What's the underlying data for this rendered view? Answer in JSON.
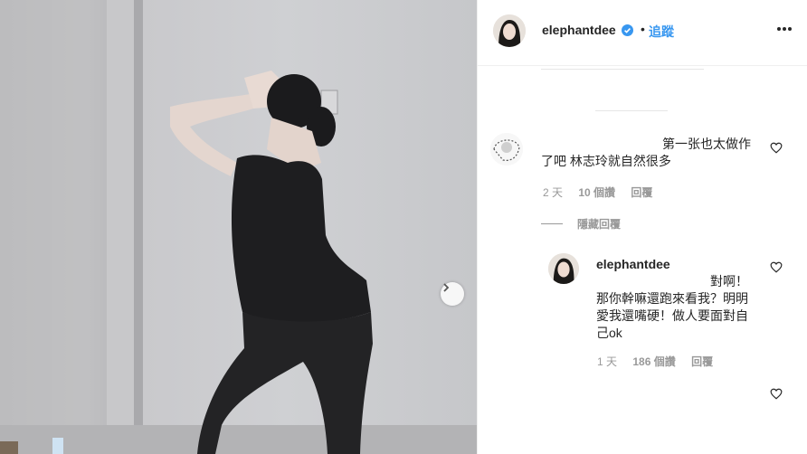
{
  "post": {
    "username": "elephantdee",
    "dot": "•",
    "follow_label": "追蹤",
    "icons": {
      "verified": "verified-badge-icon",
      "more": "more-options-icon",
      "next": "chevron-right-icon"
    }
  },
  "comment": {
    "text_line1": "第一张也太做作",
    "text_line2": "了吧 林志玲就自然很多",
    "age": "2 天",
    "likes": "10 個讚",
    "reply_label": "回覆",
    "hide_replies_label": "隱藏回覆"
  },
  "reply": {
    "username": "elephantdee",
    "text_line1": "對啊！",
    "text_rest": "那你幹嘛還跑來看我？明明愛我還嘴硬！做人要面對自己ok",
    "age": "1 天",
    "likes": "186 個讚",
    "reply_label": "回覆"
  },
  "colors": {
    "accent": "#3897f0",
    "muted": "#999999",
    "text": "#262626"
  }
}
